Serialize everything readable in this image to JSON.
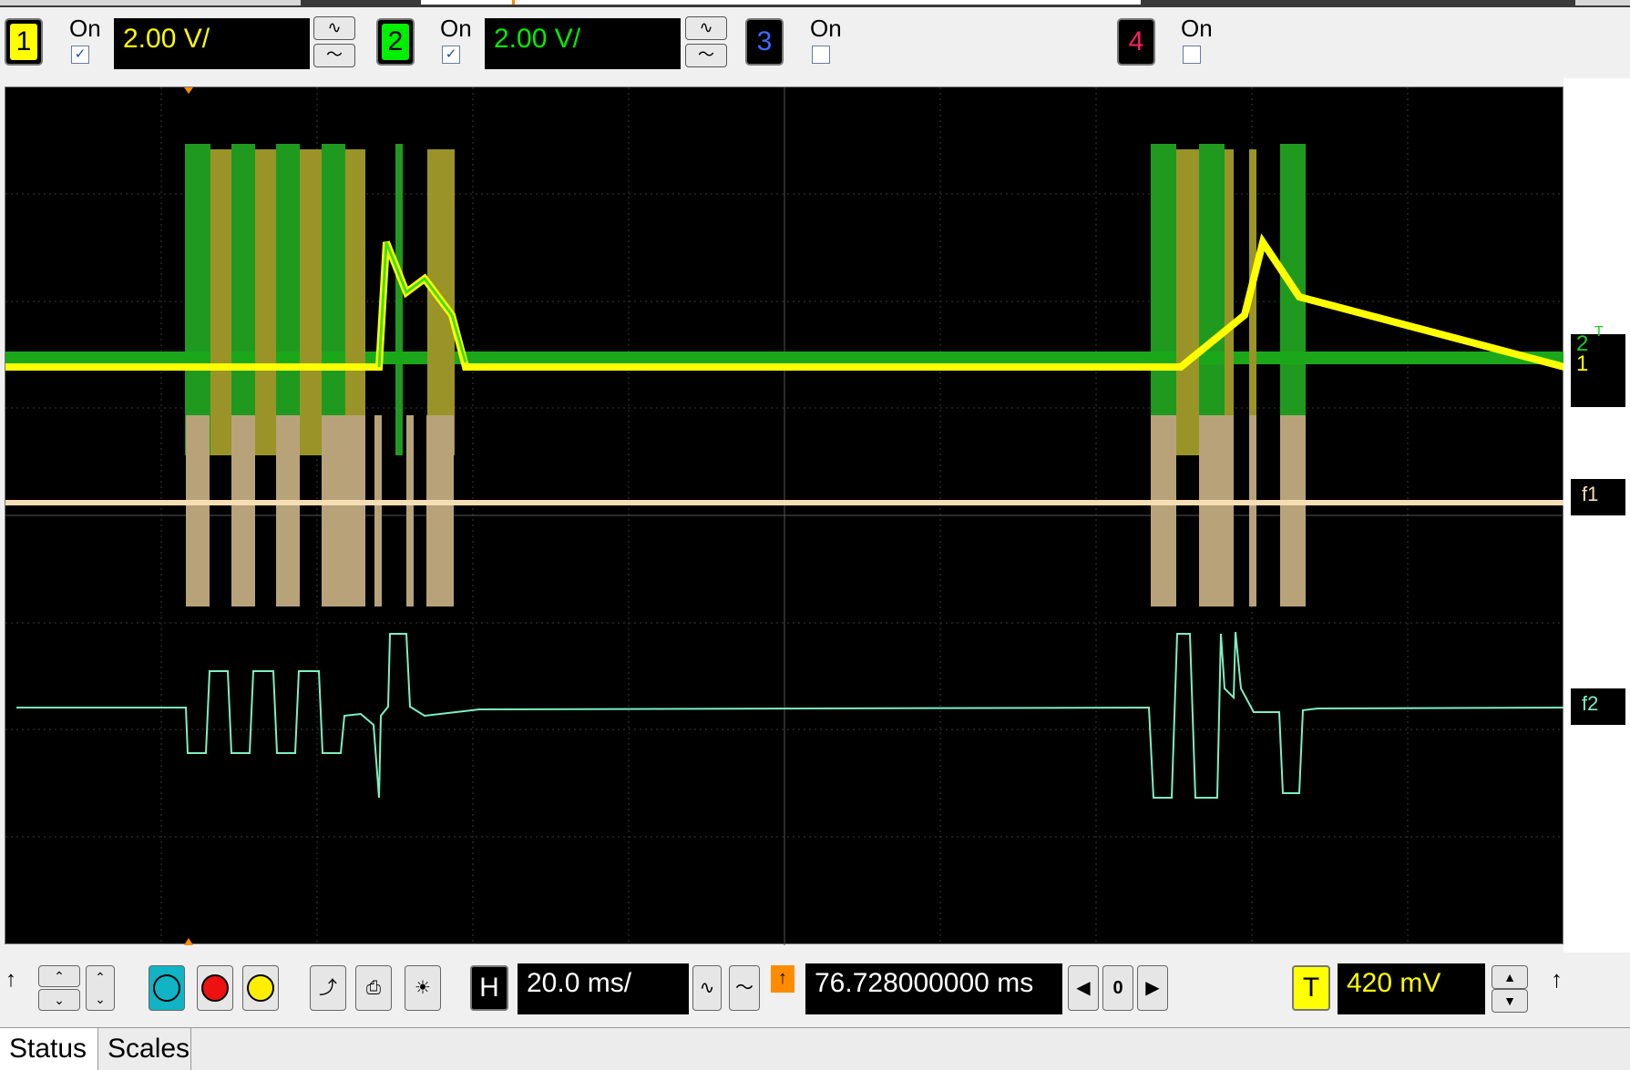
{
  "channels": [
    {
      "number": "1",
      "on_label": "On",
      "checked": true,
      "scale": "2.00 V/",
      "color": "#ffff00"
    },
    {
      "number": "2",
      "on_label": "On",
      "checked": true,
      "scale": "2.00 V/",
      "color": "#00ee00"
    },
    {
      "number": "3",
      "on_label": "On",
      "checked": false,
      "color": "#3a6cff"
    },
    {
      "number": "4",
      "on_label": "On",
      "checked": false,
      "color": "#ff2060"
    }
  ],
  "coupling_icons": [
    "ac-coupling-icon",
    "dc-coupling-icon"
  ],
  "markers": {
    "ch2": "2",
    "ch2_t": "T",
    "ch1": "1",
    "f1": "f1",
    "f2": "f2"
  },
  "bottom": {
    "horizontal_label": "H",
    "timebase": "20.0 ms/",
    "delay": "76.728000000 ms",
    "nav_value": "0",
    "trigger_label": "T",
    "trigger_level": "420 mV",
    "colors": {
      "cyan": "#11b4c4",
      "red": "#ee1111",
      "yellow": "#ffee00"
    }
  },
  "tabs": [
    {
      "label": "Status",
      "active": true
    },
    {
      "label": "Scales",
      "active": false
    }
  ],
  "trace_colors": {
    "ch1": "#ffff00",
    "ch2": "#22cc22",
    "f1": "#f5deb3",
    "f2": "#7cf0c0"
  }
}
